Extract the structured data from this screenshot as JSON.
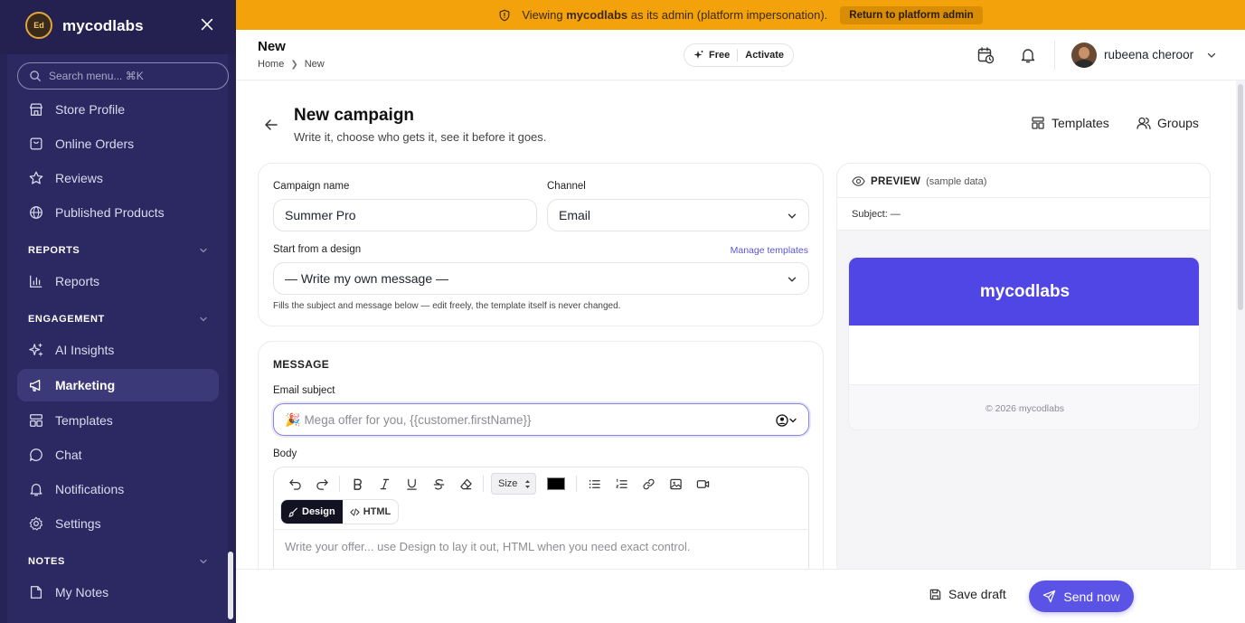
{
  "colors": {
    "sidebar_bg": "#2b2862",
    "banner_bg": "#f4a20b",
    "accent": "#5b53e6",
    "preview_header": "#4f46e5"
  },
  "sidebar": {
    "brand": "mycodlabs",
    "logo_text": "Ed",
    "search_placeholder": "Search menu... ⌘K",
    "items_top": [
      {
        "label": "Store Profile",
        "icon": "store-icon"
      },
      {
        "label": "Online Orders",
        "icon": "bag-icon"
      },
      {
        "label": "Reviews",
        "icon": "star-icon"
      },
      {
        "label": "Published Products",
        "icon": "globe-icon"
      }
    ],
    "sections": {
      "reports": {
        "title": "REPORTS",
        "items": [
          {
            "label": "Reports",
            "icon": "bar-chart-icon"
          }
        ]
      },
      "engagement": {
        "title": "ENGAGEMENT",
        "items": [
          {
            "label": "AI Insights",
            "icon": "sparkles-icon"
          },
          {
            "label": "Marketing",
            "icon": "megaphone-icon",
            "active": true
          },
          {
            "label": "Templates",
            "icon": "layout-icon"
          },
          {
            "label": "Chat",
            "icon": "chat-icon"
          },
          {
            "label": "Notifications",
            "icon": "bell-icon"
          },
          {
            "label": "Settings",
            "icon": "gear-icon"
          }
        ]
      },
      "notes": {
        "title": "NOTES",
        "items": [
          {
            "label": "My Notes",
            "icon": "note-icon"
          }
        ]
      }
    }
  },
  "banner": {
    "prefix": "Viewing",
    "org": "mycodlabs",
    "suffix": "as its admin (platform impersonation).",
    "button": "Return to platform admin"
  },
  "header": {
    "title": "New",
    "breadcrumb": [
      "Home",
      "New"
    ],
    "plan": "Free",
    "plan_action": "Activate",
    "user_name": "rubeena cheroor"
  },
  "page": {
    "title": "New campaign",
    "subtitle": "Write it, choose who gets it, see it before it goes.",
    "actions": {
      "templates": "Templates",
      "groups": "Groups"
    }
  },
  "form": {
    "campaign_name_label": "Campaign name",
    "campaign_name_value": "Summer Pro",
    "channel_label": "Channel",
    "channel_value": "Email",
    "design_label": "Start from a design",
    "manage_templates": "Manage templates",
    "design_value": "— Write my own message —",
    "design_hint": "Fills the subject and message below — edit freely, the template itself is never changed."
  },
  "message": {
    "section_title": "MESSAGE",
    "subject_label": "Email subject",
    "subject_emoji": "🎉",
    "subject_placeholder": "Mega offer for you, {{customer.firstName}}",
    "body_label": "Body",
    "size_label": "Size",
    "mode_design": "Design",
    "mode_html": "HTML",
    "body_placeholder": "Write your offer... use Design to lay it out, HTML when you need exact control."
  },
  "preview": {
    "title": "PREVIEW",
    "note": "(sample data)",
    "subject_line": "Subject: —",
    "brand": "mycodlabs",
    "footer": "© 2026 mycodlabs"
  },
  "footer": {
    "save_draft": "Save draft",
    "send_now": "Send now"
  }
}
